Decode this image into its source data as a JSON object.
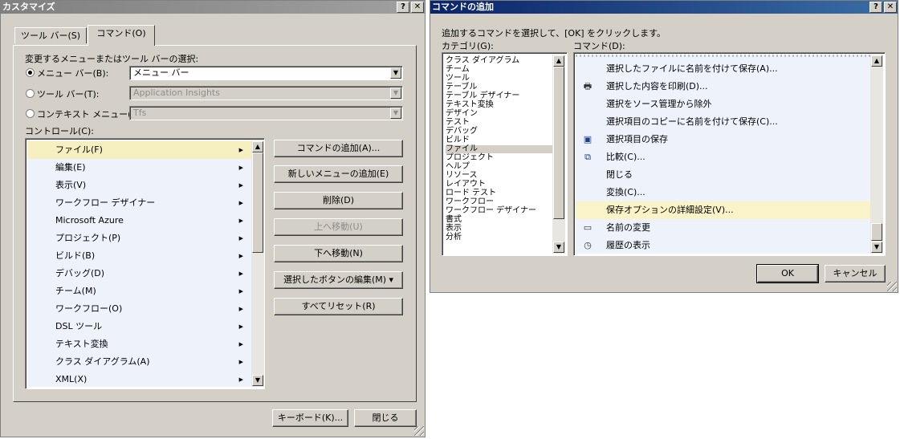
{
  "customize": {
    "title": "カスタマイズ",
    "help_button": "?",
    "close_button": "✕",
    "tabs": [
      {
        "label": "ツール バー(S)"
      },
      {
        "label": "コマンド(O)"
      }
    ],
    "select_label": "変更するメニューまたはツール バーの選択:",
    "menubar_radio": "メニュー バー(B):",
    "menubar_value": "メニュー バー",
    "toolbar_radio": "ツール バー(T):",
    "toolbar_value": "Application Insights",
    "context_radio": "コンテキスト メニュー(X):",
    "context_value": "Tfs",
    "controls_label": "コントロール(C):",
    "controls": [
      {
        "label": "ファイル(F)"
      },
      {
        "label": "編集(E)"
      },
      {
        "label": "表示(V)"
      },
      {
        "label": "ワークフロー デザイナー"
      },
      {
        "label": "Microsoft Azure"
      },
      {
        "label": "プロジェクト(P)"
      },
      {
        "label": "ビルド(B)"
      },
      {
        "label": "デバッグ(D)"
      },
      {
        "label": "チーム(M)"
      },
      {
        "label": "ワークフロー(O)"
      },
      {
        "label": "DSL ツール"
      },
      {
        "label": "テキスト変換"
      },
      {
        "label": "クラス ダイアグラム(A)"
      },
      {
        "label": "XML(X)"
      }
    ],
    "buttons": {
      "add_command": "コマンドの追加(A)...",
      "add_menu": "新しいメニューの追加(E)",
      "delete": "削除(D)",
      "move_up": "上へ移動(U)",
      "move_down": "下へ移動(N)",
      "modify": "選択したボタンの編集(M) ▾",
      "reset_all": "すべてリセット(R)",
      "keyboard": "キーボード(K)...",
      "close": "閉じる"
    }
  },
  "add_command": {
    "title": "コマンドの追加",
    "help_button": "?",
    "close_button": "✕",
    "instruction": "追加するコマンドを選択して、[OK] をクリックします。",
    "category_label": "カテゴリ(G):",
    "command_label": "コマンド(D):",
    "categories": [
      {
        "label": "クラス ダイアグラム"
      },
      {
        "label": "チーム"
      },
      {
        "label": "ツール"
      },
      {
        "label": "テーブル"
      },
      {
        "label": "テーブル デザイナー"
      },
      {
        "label": "テキスト変換"
      },
      {
        "label": "デザイン"
      },
      {
        "label": "テスト"
      },
      {
        "label": "デバッグ"
      },
      {
        "label": "ビルド"
      },
      {
        "label": "ファイル"
      },
      {
        "label": "プロジェクト"
      },
      {
        "label": "ヘルプ"
      },
      {
        "label": "リソース"
      },
      {
        "label": "レイアウト"
      },
      {
        "label": "ロード テスト"
      },
      {
        "label": "ワークフロー"
      },
      {
        "label": "ワークフロー デザイナー"
      },
      {
        "label": "書式"
      },
      {
        "label": "表示"
      },
      {
        "label": "分析"
      }
    ],
    "selected_category": "ファイル",
    "commands": [
      {
        "label": "選択したファイルに名前を付けて保存(A)...",
        "icon": "none"
      },
      {
        "label": "選択した内容を印刷(D)...",
        "icon": "printer-icon"
      },
      {
        "label": "選択をソース管理から除外",
        "icon": "none"
      },
      {
        "label": "選択項目のコピーに名前を付けて保存(C)...",
        "icon": "none"
      },
      {
        "label": "選択項目の保存",
        "icon": "save-icon"
      },
      {
        "label": "比較(C)...",
        "icon": "compare-icon"
      },
      {
        "label": "閉じる",
        "icon": "none"
      },
      {
        "label": "変換(C)...",
        "icon": "none"
      },
      {
        "label": "保存オプションの詳細設定(V)...",
        "icon": "none"
      },
      {
        "label": "名前の変更",
        "icon": "rename-icon"
      },
      {
        "label": "履歴の表示",
        "icon": "history-icon"
      }
    ],
    "selected_command": "保存オプションの詳細設定(V)...",
    "ok": "OK",
    "cancel": "キャンセル"
  },
  "colors": {
    "dialog_face": "#d4d0c8",
    "active_title": "#0a246a",
    "list_background": "#eef3fb",
    "command_highlight": "#fbf3c8"
  }
}
